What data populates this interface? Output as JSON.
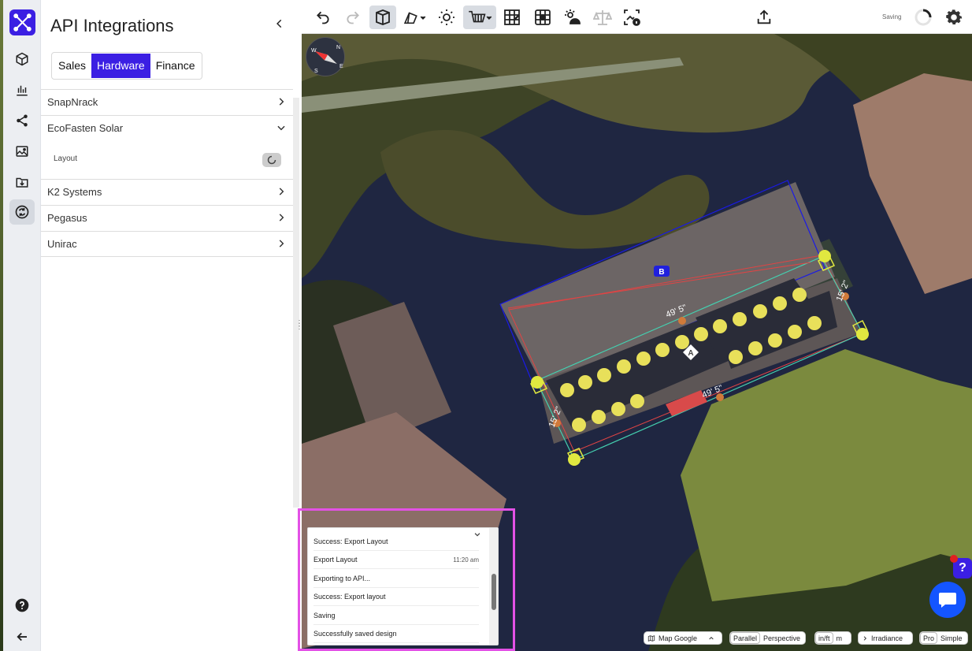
{
  "panel": {
    "title": "API Integrations",
    "tabs": [
      {
        "label": "Sales",
        "active": false
      },
      {
        "label": "Hardware",
        "active": true
      },
      {
        "label": "Finance",
        "active": false
      }
    ],
    "accordion": [
      {
        "label": "SnapNrack",
        "expanded": false
      },
      {
        "label": "EcoFasten Solar",
        "expanded": true,
        "content_label": "Layout"
      },
      {
        "label": "K2 Systems",
        "expanded": false
      },
      {
        "label": "Pegasus",
        "expanded": false
      },
      {
        "label": "Unirac",
        "expanded": false
      }
    ]
  },
  "sidebar": {
    "icons": [
      "logo-icon",
      "cube-icon",
      "bar-chart-icon",
      "share-icon",
      "image-icon",
      "download-folder-icon",
      "sync-icon",
      "help-icon",
      "back-arrow-icon"
    ],
    "active": "sync-icon"
  },
  "toolbar": {
    "status_text": "Saving",
    "icons": [
      "undo-icon",
      "redo-icon",
      "3d-box-icon",
      "roof-shape-icon",
      "sun-orbit-icon",
      "panel-cart-icon",
      "panel-grid-icon",
      "globe-grid-icon",
      "shade-icon",
      "balance-icon",
      "image-info-icon",
      "export-icon",
      "spinner-icon",
      "settings-icon"
    ]
  },
  "map": {
    "compass_letters": [
      "N",
      "E",
      "S",
      "W"
    ],
    "roof_labels": {
      "a": "A",
      "b": "B"
    },
    "dimensions": [
      "49' 5\"",
      "49' 5\"",
      "15' 2\"",
      "15' 2\""
    ]
  },
  "log": {
    "items": [
      {
        "text": "Success: Export Layout",
        "time": ""
      },
      {
        "text": "Export Layout",
        "time": "11:20 am"
      },
      {
        "text": "Exporting to API...",
        "time": ""
      },
      {
        "text": "Success: Export layout",
        "time": ""
      },
      {
        "text": "Saving",
        "time": ""
      },
      {
        "text": "Successfully saved design",
        "time": ""
      }
    ]
  },
  "bottom_bar": {
    "map_source": {
      "icon": "map-icon",
      "label": "Map Google"
    },
    "projection": {
      "options": [
        "Parallel",
        "Perspective"
      ],
      "selected": "Parallel"
    },
    "units": {
      "options": [
        "in/ft",
        "m"
      ],
      "selected": "in/ft"
    },
    "irradiance": {
      "label": "Irradiance"
    },
    "mode": {
      "options": [
        "Pro",
        "Simple"
      ],
      "selected": "Pro"
    }
  },
  "colors": {
    "accent": "#3b1fe3",
    "chat": "#1455ff",
    "log_highlight": "#e351e6",
    "panel_yellow": "#e8e05a",
    "outline_blue": "#1a1ae6",
    "outline_red": "#e04444",
    "outline_teal": "#44d0b0"
  }
}
